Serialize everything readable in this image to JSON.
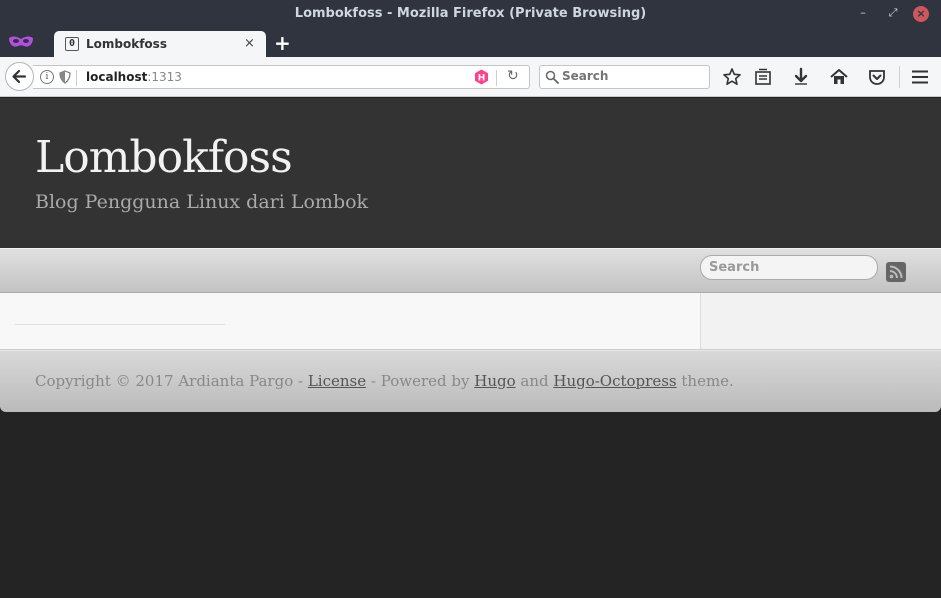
{
  "window": {
    "title": "Lombokfoss - Mozilla Firefox (Private Browsing)",
    "minimize": "–",
    "maximize": "⤢",
    "close": "×"
  },
  "tab": {
    "favicon": "0",
    "label": "Lombokfoss",
    "close": "×",
    "new_tab": "+"
  },
  "urlbar": {
    "host": "localhost",
    "port": ":1313"
  },
  "searchbar": {
    "placeholder": "Search"
  },
  "site": {
    "title": "Lombokfoss",
    "subtitle": "Blog Pengguna Linux dari Lombok",
    "search_placeholder": "Search"
  },
  "footer": {
    "prefix": "Copyright © 2017 Ardianta Pargo - ",
    "license": "License",
    "mid1": " - Powered by ",
    "hugo": "Hugo",
    "mid2": " and ",
    "theme": "Hugo-Octopress",
    "suffix": " theme."
  },
  "colors": {
    "titlebar": "#2f343f",
    "toolbar": "#f5f6f7",
    "header": "#333333",
    "page_bg": "#242424",
    "hugo_badge": "#ff4088"
  },
  "icons": [
    "private-mask-icon",
    "info-icon",
    "shield-icon",
    "hugo-icon",
    "reload-icon",
    "search-icon",
    "star-icon",
    "library-icon",
    "download-icon",
    "home-icon",
    "pocket-icon",
    "menu-icon",
    "rss-icon"
  ]
}
